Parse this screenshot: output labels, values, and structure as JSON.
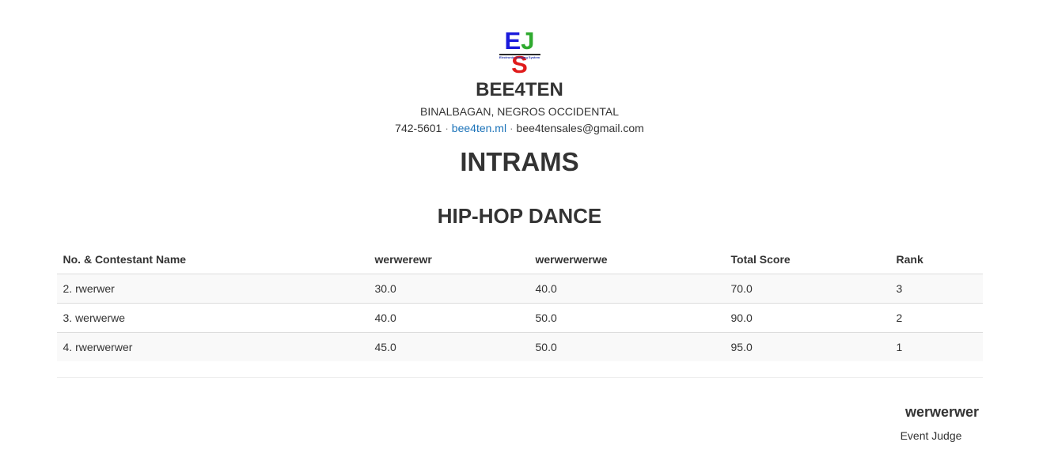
{
  "brand": {
    "logo_text": "EJS",
    "logo_letters": [
      "E",
      "J",
      "S"
    ],
    "logo_colors": [
      "#1a1adb",
      "#2faa2f",
      "#e01b1b"
    ],
    "logo_subtitle": "Electronic Judging System",
    "name": "BEE4TEN",
    "address": "BINALBAGAN, NEGROS OCCIDENTAL",
    "phone": "742-5601",
    "website": "bee4ten.ml",
    "email": "bee4tensales@gmail.com",
    "separator": "·"
  },
  "event": {
    "title": "INTRAMS",
    "category": "HIP-HOP DANCE"
  },
  "results_table": {
    "columns": [
      "No. & Contestant Name",
      "werwerewr",
      "werwerwerwe",
      "Total Score",
      "Rank"
    ],
    "rows": [
      [
        "2. rwerwer",
        "30.0",
        "40.0",
        "70.0",
        "3"
      ],
      [
        "3. werwerwe",
        "40.0",
        "50.0",
        "90.0",
        "2"
      ],
      [
        "4. rwerwerwer",
        "45.0",
        "50.0",
        "95.0",
        "1"
      ]
    ]
  },
  "judge": {
    "name": "werwerwer",
    "title": "Event Judge"
  }
}
